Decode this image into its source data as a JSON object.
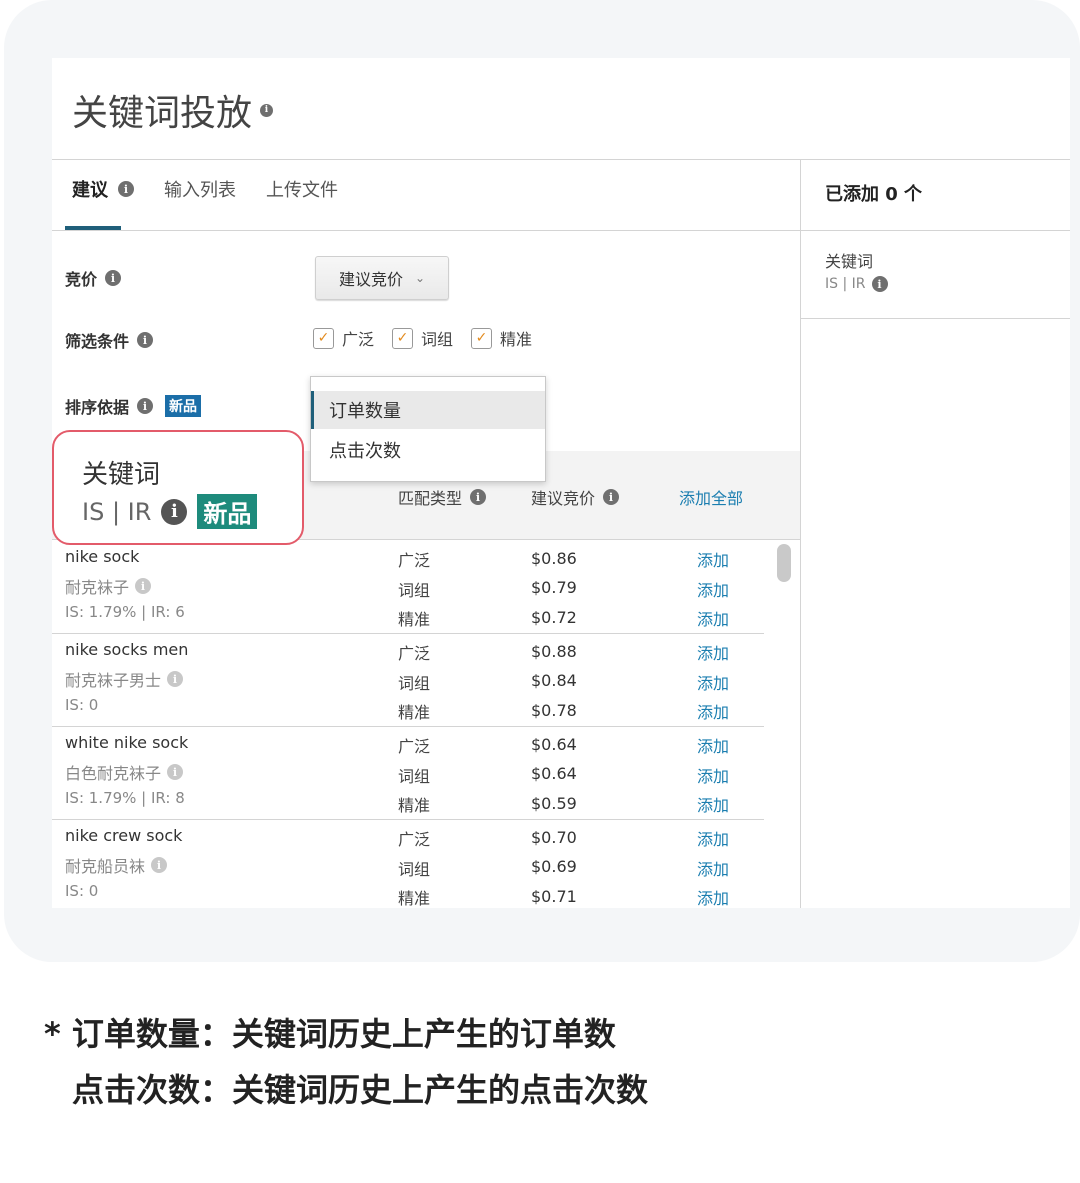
{
  "title": "关键词投放",
  "tabs": [
    {
      "label": "建议"
    },
    {
      "label": "输入列表"
    },
    {
      "label": "上传文件"
    }
  ],
  "right_panel": {
    "added": "已添加 0 个",
    "keyword_header": "关键词",
    "sub": "IS | IR"
  },
  "bid": {
    "label": "竞价",
    "select_value": "建议竞价"
  },
  "filter": {
    "label": "筛选条件",
    "options": [
      "广泛",
      "词组",
      "精准"
    ]
  },
  "sort": {
    "label": "排序依据",
    "badge": "新品",
    "options": [
      "订单数量",
      "点击次数"
    ]
  },
  "table_header": {
    "keyword": "关键词",
    "sub": "IS | IR",
    "badge": "新品",
    "match_type": "匹配类型",
    "suggested_bid": "建议竞价",
    "add_all": "添加全部"
  },
  "rows": [
    {
      "keyword": "nike sock",
      "translation": "耐克袜子",
      "stats": "IS: 1.79% | IR: 6",
      "types": [
        "广泛",
        "词组",
        "精准"
      ],
      "bids": [
        "$0.86",
        "$0.79",
        "$0.72"
      ],
      "action": "添加"
    },
    {
      "keyword": "nike socks men",
      "translation": "耐克袜子男士",
      "stats": "IS: 0",
      "types": [
        "广泛",
        "词组",
        "精准"
      ],
      "bids": [
        "$0.88",
        "$0.84",
        "$0.78"
      ],
      "action": "添加"
    },
    {
      "keyword": "white nike sock",
      "translation": "白色耐克袜子",
      "stats": "IS: 1.79% | IR: 8",
      "types": [
        "广泛",
        "词组",
        "精准"
      ],
      "bids": [
        "$0.64",
        "$0.64",
        "$0.59"
      ],
      "action": "添加"
    },
    {
      "keyword": "nike crew sock",
      "translation": "耐克船员袜",
      "stats": "IS: 0",
      "types": [
        "广泛",
        "词组",
        "精准"
      ],
      "bids": [
        "$0.70",
        "$0.69",
        "$0.71"
      ],
      "action": "添加"
    }
  ],
  "footnote": {
    "line1": "* 订单数量：关键词历史上产生的订单数",
    "line2": "点击次数：关键词历史上产生的点击次数"
  },
  "colors": {
    "link": "#1b7eb0",
    "tab_underline": "#1f5f7a",
    "new_badge_blue": "#1b6ea8",
    "new_badge_teal": "#1e8b7c",
    "highlight_border": "#e35b6a",
    "check": "#e38b1f"
  }
}
